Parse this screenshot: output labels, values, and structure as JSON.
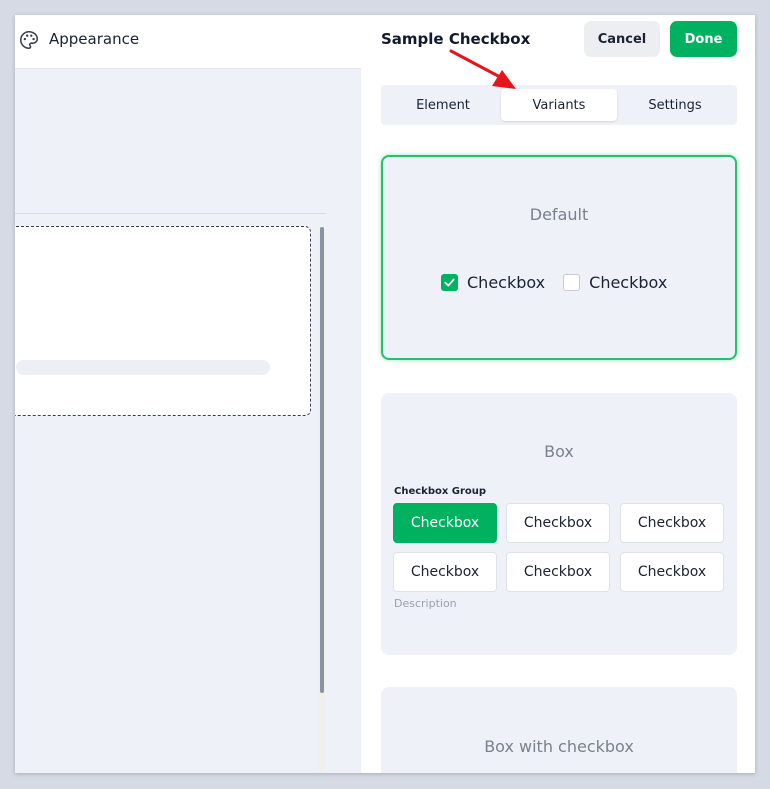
{
  "left_panel": {
    "title": "Appearance",
    "icon": "palette-icon"
  },
  "right_panel": {
    "title": "Sample Checkbox",
    "cancel_label": "Cancel",
    "done_label": "Done",
    "tabs": [
      {
        "label": "Element",
        "active": false
      },
      {
        "label": "Variants",
        "active": true
      },
      {
        "label": "Settings",
        "active": false
      }
    ],
    "variants": {
      "default": {
        "title": "Default",
        "options": [
          {
            "label": "Checkbox",
            "checked": true
          },
          {
            "label": "Checkbox",
            "checked": false
          }
        ]
      },
      "box": {
        "title": "Box",
        "group_label": "Checkbox Group",
        "items": [
          "Checkbox",
          "Checkbox",
          "Checkbox",
          "Checkbox",
          "Checkbox",
          "Checkbox"
        ],
        "selected_index": 0,
        "description": "Description"
      },
      "box_with_checkbox": {
        "title": "Box with checkbox"
      }
    }
  },
  "colors": {
    "accent_green": "#00b25f",
    "annotation_arrow": "#e8141c"
  }
}
